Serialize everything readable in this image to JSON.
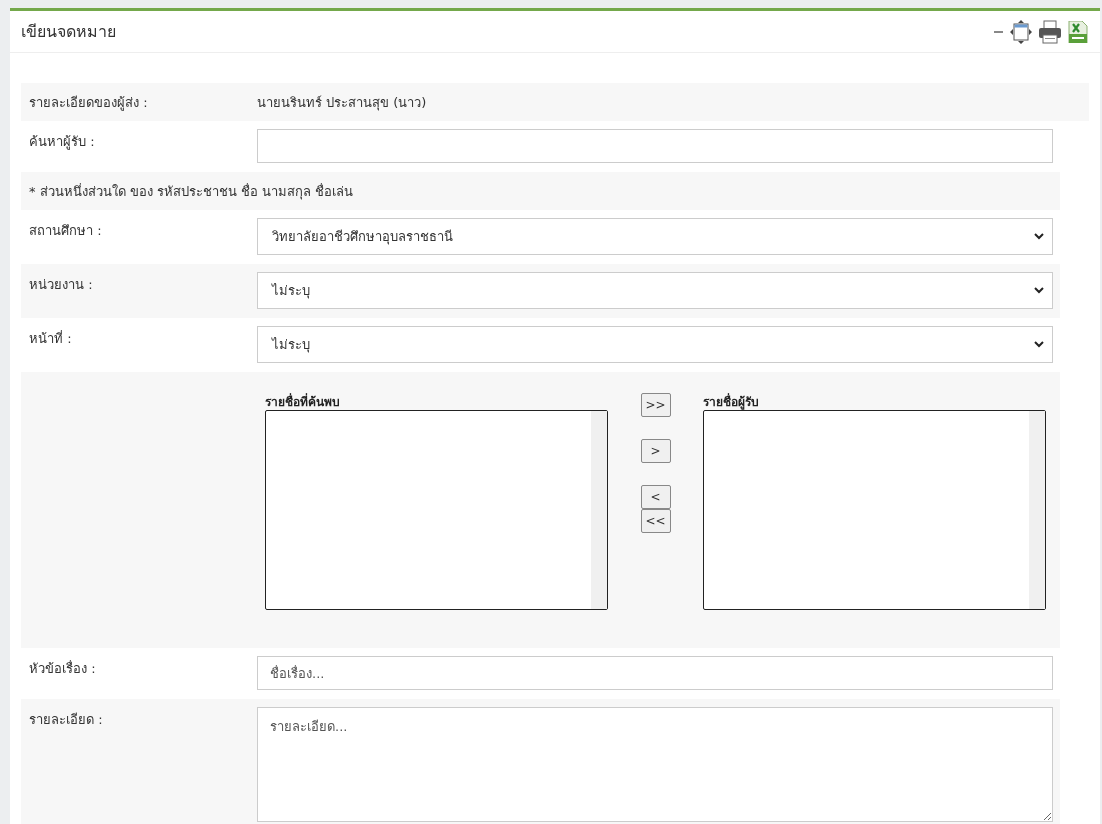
{
  "panel": {
    "title": "เขียนจดหมาย"
  },
  "rows": [
    {
      "kind": "text",
      "label": "รายละเอียดของผู้ส่ง :",
      "value": "นายนรินทร์ ประสานสุข (นาว)"
    },
    {
      "kind": "input",
      "label": "ค้นหาผู้รับ :"
    },
    {
      "kind": "note",
      "text": "* ส่วนหนึ่งส่วนใด ของ รหัสประชาชน ชื่อ นามสกุล ชื่อเล่น"
    },
    {
      "kind": "select",
      "label": "สถานศึกษา :",
      "value": "วิทยาลัยอาชีวศึกษาอุบลราชธานี"
    },
    {
      "kind": "select",
      "label": "หน่วยงาน :",
      "value": "ไม่ระบุ"
    },
    {
      "kind": "select",
      "label": "หน้าที่ :",
      "value": "ไม่ระบุ"
    },
    {
      "kind": "transfer",
      "found_label": "รายชื่อที่ค้นพบ",
      "recipients_label": "รายชื่อผู้รับ",
      "buttons": [
        ">>",
        ">",
        "<",
        "<<"
      ]
    },
    {
      "kind": "input",
      "label": "หัวข้อเรื่อง :",
      "placeholder": "ชื่อเรื่อง..."
    },
    {
      "kind": "textarea",
      "label": "รายละเอียด :",
      "placeholder": "รายละเอียด..."
    }
  ]
}
